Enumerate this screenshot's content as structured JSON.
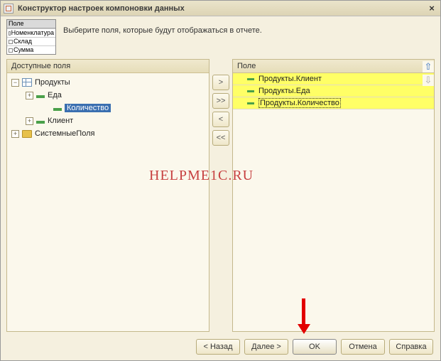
{
  "title": "Конструктор настроек компоновки данных",
  "mini_table": {
    "header": "Поле",
    "rows": [
      "Номенклатура",
      "Склад",
      "Сумма"
    ]
  },
  "instruction": "Выберите поля, которые будут отображаться в отчете.",
  "left_panel": {
    "header": "Доступные поля",
    "tree": {
      "products": "Продукты",
      "eda": "Еда",
      "quantity": "Количество",
      "client": "Клиент",
      "system_fields": "СистемныеПоля"
    }
  },
  "mid_buttons": {
    "add": ">",
    "add_all": ">>",
    "remove": "<",
    "remove_all": "<<"
  },
  "right_panel": {
    "header": "Поле",
    "items": [
      "Продукты.Клиент",
      "Продукты.Еда",
      "Продукты.Количество"
    ],
    "up": "⇧",
    "down": "⇩"
  },
  "watermark": "HELPME1C.RU",
  "footer": {
    "back": "< Назад",
    "next": "Далее >",
    "ok": "OK",
    "cancel": "Отмена",
    "help": "Справка"
  }
}
